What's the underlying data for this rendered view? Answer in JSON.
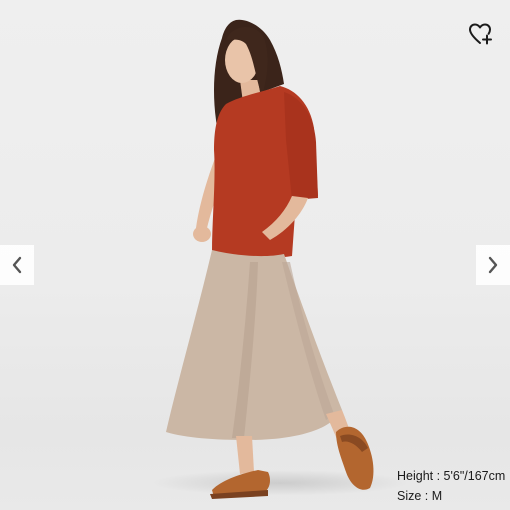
{
  "product_viewer": {
    "wishlist": {
      "icon": "heart-plus-icon"
    },
    "nav": {
      "prev_icon": "chevron-left-icon",
      "next_icon": "chevron-right-icon"
    },
    "model_info": {
      "height_text": "Height : 5'6\"/167cm",
      "size_text": "Size : M"
    },
    "colors": {
      "top": "#b53a22",
      "skirt": "#cbb7a5",
      "sandals": "#b3662f",
      "hair": "#3b241a",
      "skin": "#e9c4a9",
      "background": "#ededed"
    }
  }
}
